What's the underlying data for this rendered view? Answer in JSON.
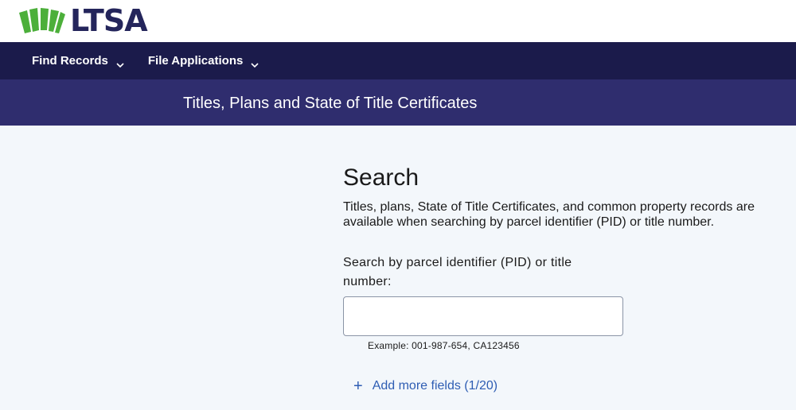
{
  "brand": {
    "logo_text": "LTSA",
    "logo_icon": "ltsa-fan-logo-icon",
    "colors": {
      "logo_green": "#4caf3a",
      "logo_navy": "#24255b"
    }
  },
  "nav": {
    "items": [
      {
        "label": "Find Records",
        "icon": "chevron-down-icon"
      },
      {
        "label": "File Applications",
        "icon": "chevron-down-icon"
      }
    ],
    "colors": {
      "background": "#1b1b4b",
      "text": "#ffffff"
    }
  },
  "banner": {
    "title": "Titles, Plans and State of Title Certificates",
    "color": "#2f2d6e"
  },
  "search": {
    "heading": "Search",
    "description": "Titles, plans, State of Title Certificates, and common property records are available when searching by parcel identifier (PID) or title number.",
    "field_label": "Search by parcel identifier (PID) or title number:",
    "input_value": "",
    "example": "Example: 001-987-654, CA123456",
    "add_more_label": "Add more fields (1/20)",
    "add_more_icon": "plus-icon",
    "link_color": "#2e5db3"
  }
}
